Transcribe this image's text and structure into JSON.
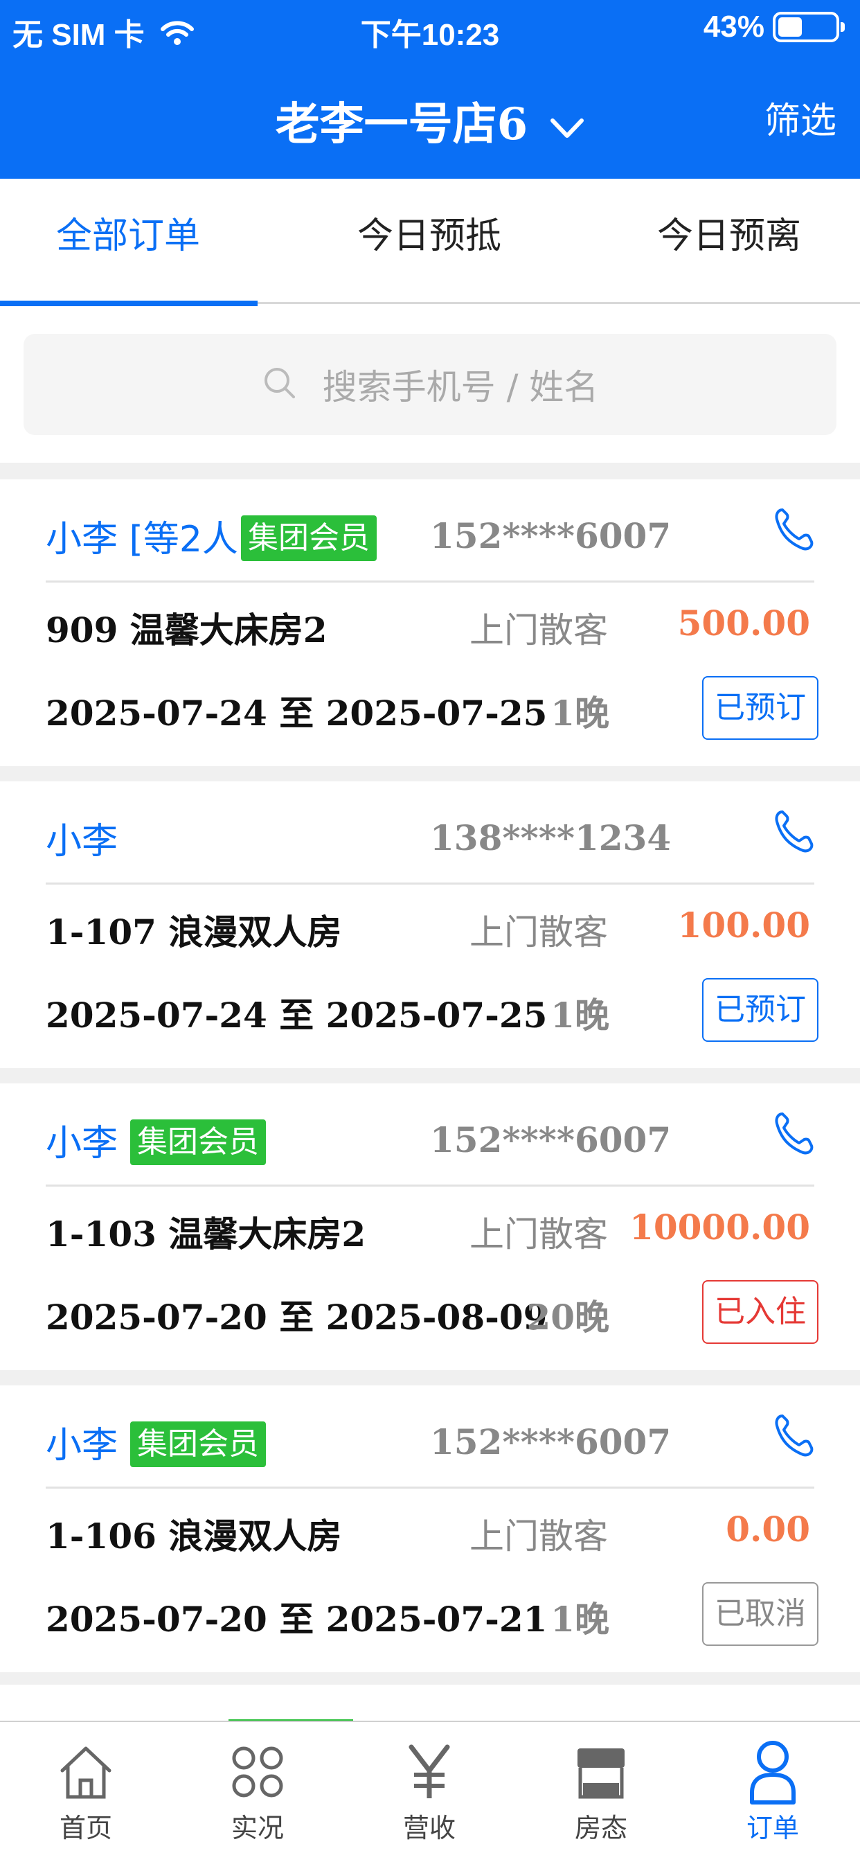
{
  "status_bar": {
    "carrier": "无 SIM 卡",
    "time": "下午10:23",
    "battery": "43%",
    "battery_level": 0.43
  },
  "nav": {
    "title": "老李一号店6",
    "filter_label": "筛选"
  },
  "tabs": [
    {
      "label": "全部订单",
      "active": true
    },
    {
      "label": "今日预抵",
      "active": false
    },
    {
      "label": "今日预离",
      "active": false
    }
  ],
  "search": {
    "placeholder": "搜索手机号 / 姓名"
  },
  "orders": [
    {
      "name": "小李 [等2人]",
      "badge": "集团会员",
      "phone": "152****6007",
      "room": "909 温馨大床房2",
      "source": "上门散客",
      "price": "500.00",
      "dates": "2025-07-24 至 2025-07-25",
      "nights": "1晚",
      "status": "已预订",
      "status_color": "#0a6ff5"
    },
    {
      "name": "小李",
      "badge": "",
      "phone": "138****1234",
      "room": "1-107 浪漫双人房",
      "source": "上门散客",
      "price": "100.00",
      "dates": "2025-07-24 至 2025-07-25",
      "nights": "1晚",
      "status": "已预订",
      "status_color": "#0a6ff5"
    },
    {
      "name": "小李",
      "badge": "集团会员",
      "phone": "152****6007",
      "room": "1-103 温馨大床房2",
      "source": "上门散客",
      "price": "10000.00",
      "dates": "2025-07-20 至 2025-08-09",
      "nights": "20晚",
      "status": "已入住",
      "status_color": "#e53935"
    },
    {
      "name": "小李",
      "badge": "集团会员",
      "phone": "152****6007",
      "room": "1-106 浪漫双人房",
      "source": "上门散客",
      "price": "0.00",
      "dates": "2025-07-20 至 2025-07-21",
      "nights": "1晚",
      "status": "已取消",
      "status_color": "#999999"
    }
  ],
  "tabbar": [
    {
      "label": "首页",
      "icon": "home-icon",
      "active": false
    },
    {
      "label": "实况",
      "icon": "grid-circles-icon",
      "active": false
    },
    {
      "label": "营收",
      "icon": "yen-icon",
      "active": false
    },
    {
      "label": "房态",
      "icon": "store-icon",
      "active": false
    },
    {
      "label": "订单",
      "icon": "person-icon",
      "active": true
    }
  ],
  "colors": {
    "primary": "#0a6ff5",
    "member_badge": "#2bbf3a",
    "price": "#f47a4b"
  }
}
